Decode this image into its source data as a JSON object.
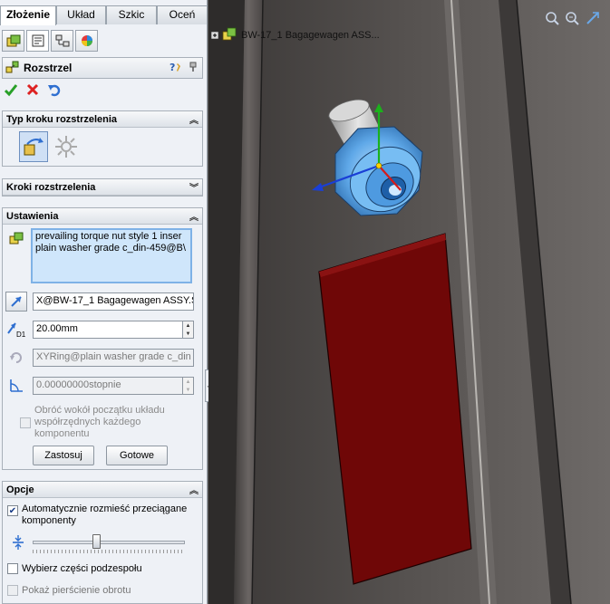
{
  "tabs": [
    "Złożenie",
    "Układ",
    "Szkic",
    "Oceń"
  ],
  "active_tab": "Złożenie",
  "property_manager": {
    "title": "Rozstrzel",
    "help_icon": "help-icon",
    "ok_icon": "check-icon",
    "cancel_icon": "x-icon",
    "undo_icon": "undo-icon"
  },
  "groups": {
    "step_type": {
      "title": "Typ kroku rozstrzelenia"
    },
    "steps": {
      "title": "Kroki rozstrzelenia"
    },
    "settings": {
      "title": "Ustawienia",
      "components_line1": "prevailing torque nut style 1 inser",
      "components_line2": "plain washer grade c_din-459@B\\",
      "direction_value": "X@BW-17_1 Bagagewagen ASSY.S",
      "distance_value": "20.00mm",
      "distance_label": "D1",
      "rotation_axis_value": "XYRing@plain washer grade c_din",
      "rotation_angle_value": "0.00000000stopnie",
      "rotate_about_origin_label": "Obróć wokół początku układu współrzędnych każdego komponentu",
      "apply_button": "Zastosuj",
      "done_button": "Gotowe"
    },
    "options": {
      "title": "Opcje",
      "auto_space_label": "Automatycznie rozmieść przeciągane komponenty",
      "auto_space_checked": true,
      "slider_fraction": 0.42,
      "select_subassembly_label": "Wybierz części podzespołu",
      "show_rotation_rings_label": "Pokaż pierścienie obrotu"
    }
  },
  "viewport": {
    "tree_root": "BW-17_1 Bagagewagen ASS..."
  },
  "colors": {
    "accent_blue": "#2f6fd0",
    "nut_blue": "#6fb6ef",
    "plate_red": "#7a0b0b",
    "frame_gray": "#5a5654"
  }
}
